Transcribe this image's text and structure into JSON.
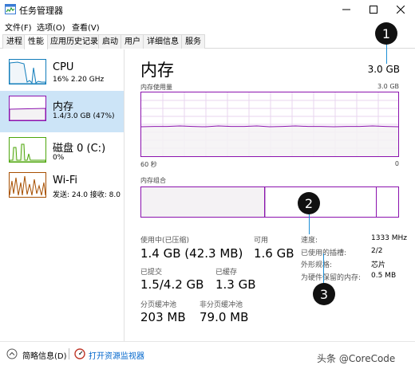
{
  "window": {
    "title": "任务管理器"
  },
  "menu": [
    "文件(F)",
    "选项(O)",
    "查看(V)"
  ],
  "tabs": [
    "进程",
    "性能",
    "应用历史记录",
    "启动",
    "用户",
    "详细信息",
    "服务"
  ],
  "active_tab": 1,
  "resources": [
    {
      "name": "CPU",
      "sub": "16% 2.20 GHz",
      "color": "#117dbb"
    },
    {
      "name": "内存",
      "sub": "1.4/3.0 GB (47%)",
      "color": "#8b12ae"
    },
    {
      "name": "磁盘 0 (C:)",
      "sub": "0%",
      "color": "#4da60c"
    },
    {
      "name": "Wi-Fi",
      "sub": "发送: 24.0  接收: 8.0",
      "color": "#a74f01"
    }
  ],
  "selected_resource": 1,
  "memory": {
    "title": "内存",
    "total": "3.0 GB",
    "usage_label": "内存使用量",
    "usage_max": "3.0 GB",
    "time_left": "60 秒",
    "time_right": "0",
    "composition_label": "内存组合",
    "usage_level": 0.47,
    "stats": {
      "in_use_label": "使用中(已压缩)",
      "in_use_value": "1.4 GB (42.3 MB)",
      "available_label": "可用",
      "available_value": "1.6 GB",
      "committed_label": "已提交",
      "committed_value": "1.5/4.2 GB",
      "cached_label": "已缓存",
      "cached_value": "1.3 GB",
      "paged_label": "分页缓冲池",
      "paged_value": "203 MB",
      "nonpaged_label": "非分页缓冲池",
      "nonpaged_value": "79.0 MB"
    },
    "details": {
      "speed_label": "速度:",
      "speed_value": "1333 MHz",
      "slots_label": "已使用的插槽:",
      "slots_value": "2/2",
      "form_label": "外形规格:",
      "form_value": "芯片",
      "reserved_label": "为硬件保留的内存:",
      "reserved_value": "0.5 MB"
    }
  },
  "footer": {
    "summary": "简略信息(D)",
    "monitor": "打开资源监视器"
  },
  "callouts": [
    "1",
    "2",
    "3"
  ],
  "watermark": "头条 @CoreCode"
}
